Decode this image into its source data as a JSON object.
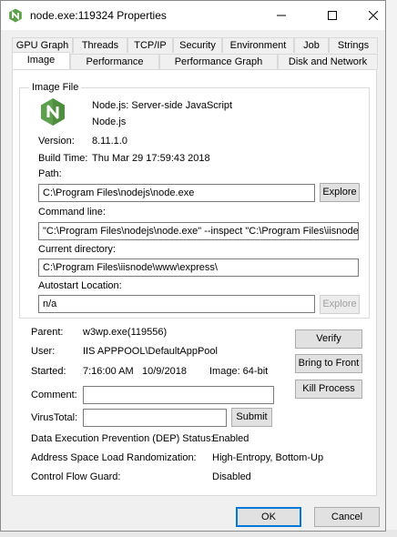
{
  "window": {
    "title": "node.exe:119324 Properties"
  },
  "tabs_row1": [
    "GPU Graph",
    "Threads",
    "TCP/IP",
    "Security",
    "Environment",
    "Job",
    "Strings"
  ],
  "tabs_row2": [
    "Image",
    "Performance",
    "Performance Graph",
    "Disk and Network"
  ],
  "active_tab": "Image",
  "image_file": {
    "group_label": "Image File",
    "description": "Node.js: Server-side JavaScript",
    "company": "Node.js",
    "version_label": "Version:",
    "version": "8.11.1.0",
    "build_time_label": "Build Time:",
    "build_time": "Thu Mar 29 17:59:43 2018",
    "path_label": "Path:",
    "path": "C:\\Program Files\\nodejs\\node.exe",
    "explore_label": "Explore",
    "command_line_label": "Command line:",
    "command_line": "\"C:\\Program Files\\nodejs\\node.exe\" --inspect \"C:\\Program Files\\iisnode",
    "current_directory_label": "Current directory:",
    "current_directory": "C:\\Program Files\\iisnode\\www\\express\\",
    "autostart_label": "Autostart Location:",
    "autostart": "n/a",
    "explore_disabled_label": "Explore"
  },
  "process": {
    "parent_label": "Parent:",
    "parent": "w3wp.exe(119556)",
    "user_label": "User:",
    "user": "IIS APPPOOL\\DefaultAppPool",
    "started_label": "Started:",
    "started_time": "7:16:00 AM",
    "started_date": "10/9/2018",
    "image_bits": "Image: 64-bit",
    "comment_label": "Comment:",
    "comment": "",
    "virustotal_label": "VirusTotal:",
    "virustotal": "",
    "submit_label": "Submit",
    "verify_label": "Verify",
    "bring_to_front_label": "Bring to Front",
    "kill_process_label": "Kill Process",
    "dep_label": "Data Execution Prevention (DEP) Status:",
    "dep_value": "Enabled",
    "aslr_label": "Address Space Load Randomization:",
    "aslr_value": "High-Entropy, Bottom-Up",
    "cfg_label": "Control Flow Guard:",
    "cfg_value": "Disabled"
  },
  "footer": {
    "ok_label": "OK",
    "cancel_label": "Cancel"
  },
  "icons": {
    "app": "nodejs-hexagon-icon",
    "window_controls": [
      "minimize-icon",
      "maximize-icon",
      "close-icon"
    ]
  },
  "colors": {
    "nodejs_green": "#5fa04e",
    "window_bg": "#f0f0f0",
    "panel_bg": "#ffffff",
    "focus_blue": "#0078d7"
  }
}
